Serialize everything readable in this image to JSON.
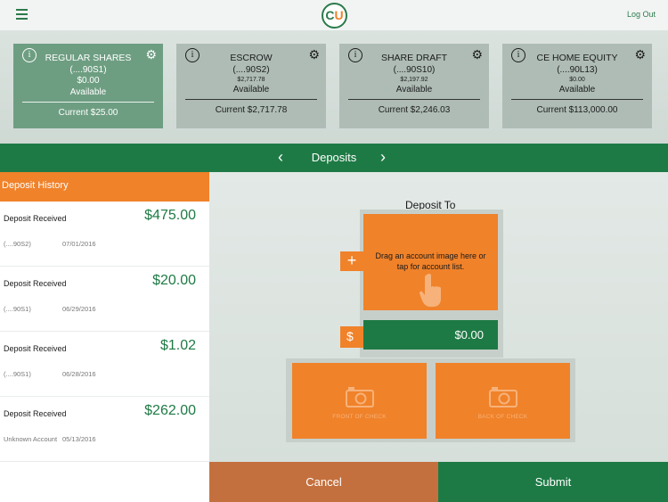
{
  "header": {
    "logo_text": "CU",
    "logout_label": "Log Out"
  },
  "accounts": [
    {
      "name": "REGULAR SHARES",
      "number": "(....90S1)",
      "balance": "$0.00",
      "available_label": "Available",
      "current": "Current $25.00",
      "active": true
    },
    {
      "name": "ESCROW",
      "number": "(....90S2)",
      "balance": "$2,717.78",
      "available_label": "Available",
      "current": "Current $2,717.78",
      "active": false
    },
    {
      "name": "SHARE DRAFT",
      "number": "(....90S10)",
      "balance": "$2,197.92",
      "available_label": "Available",
      "current": "Current $2,246.03",
      "active": false
    },
    {
      "name": "CE HOME EQUITY",
      "number": "(....90L13)",
      "balance": "$0.00",
      "available_label": "Available",
      "current": "Current $113,000.00",
      "active": false
    }
  ],
  "nav": {
    "title": "Deposits",
    "prev_icon": "chevron-left-icon",
    "next_icon": "chevron-right-icon"
  },
  "history": {
    "title": "Deposit History",
    "items": [
      {
        "label": "Deposit Received",
        "amount": "$475.00",
        "account": "(....90S2)",
        "date": "07/01/2016"
      },
      {
        "label": "Deposit Received",
        "amount": "$20.00",
        "account": "(....90S1)",
        "date": "06/29/2016"
      },
      {
        "label": "Deposit Received",
        "amount": "$1.02",
        "account": "(....90S1)",
        "date": "06/28/2016"
      },
      {
        "label": "Deposit Received",
        "amount": "$262.00",
        "account": "Unknown Account",
        "date": "05/13/2016"
      }
    ]
  },
  "deposit": {
    "title": "Deposit To",
    "instructions": "Drag an account image here or tap for account list.",
    "amount": "$0.00",
    "currency_symbol": "$",
    "front_label": "FRONT OF CHECK",
    "back_label": "BACK OF CHECK"
  },
  "actions": {
    "cancel_label": "Cancel",
    "submit_label": "Submit"
  },
  "colors": {
    "brand_green": "#1e7a45",
    "accent_orange": "#f0822a",
    "cancel_brown": "#c4703e",
    "active_account": "#6e9e82",
    "inactive_account": "#aebcb5"
  }
}
